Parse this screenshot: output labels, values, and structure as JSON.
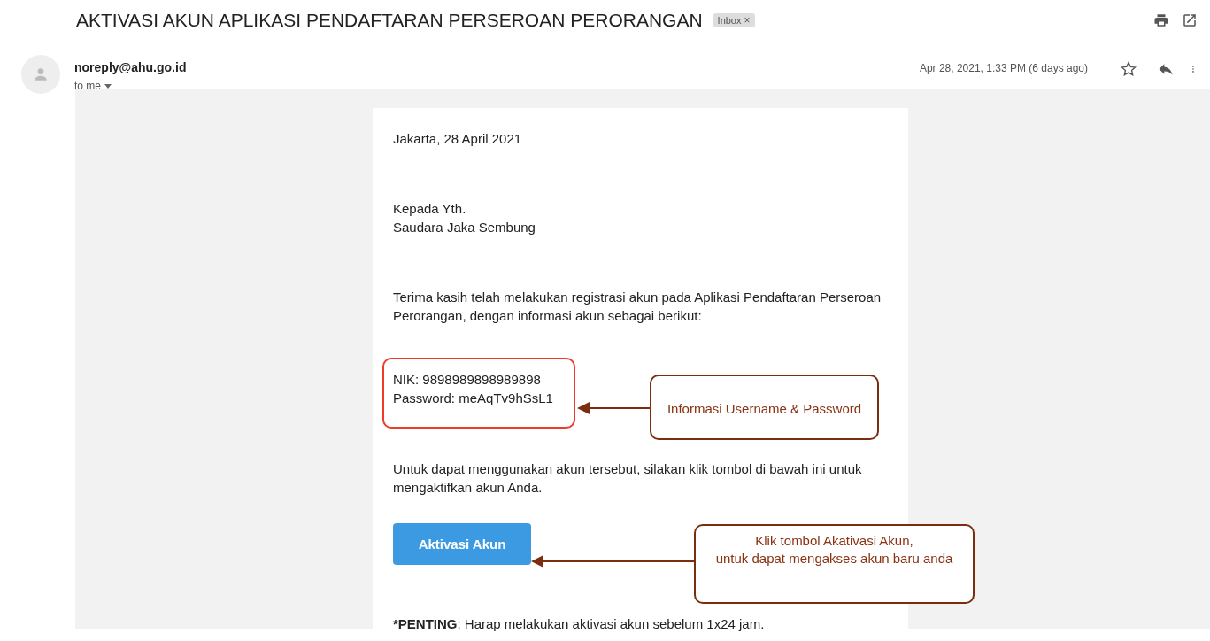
{
  "subject": "AKTIVASI AKUN APLIKASI PENDAFTARAN PERSEROAN PERORANGAN",
  "label": {
    "text": "Inbox",
    "close": "×"
  },
  "sender": {
    "address": "noreply@ahu.go.id",
    "recipient": "to me",
    "date": "Apr 28, 2021, 1:33 PM (6 days ago)",
    "starred": false
  },
  "letter": {
    "place_date": "Jakarta, 28 April 2021",
    "salutation": [
      "Kepada Yth.",
      "Saudara Jaka Sembung"
    ],
    "intro": "Terima kasih telah melakukan registrasi akun pada Aplikasi Pendaftaran Perseroan Perorangan, dengan informasi akun sebagai berikut:",
    "credentials": [
      "NIK: 9898989898989898",
      "Password: meAqTv9hSsL1"
    ],
    "instruction": "Untuk dapat menggunakan akun tersebut, silakan klik tombol di bawah ini untuk mengaktifkan akun Anda.",
    "button": "Aktivasi Akun",
    "note": {
      "emphasis": "*PENTING",
      "text": ": Harap melakukan aktivasi akun sebelum 1x24 jam."
    }
  },
  "annotations": [
    {
      "kind": "credentials",
      "lines": [
        "Informasi Username & Password"
      ]
    },
    {
      "kind": "button",
      "lines": [
        "Klik tombol Akativasi Akun,",
        "untuk dapat mengakses akun baru anda"
      ]
    }
  ]
}
